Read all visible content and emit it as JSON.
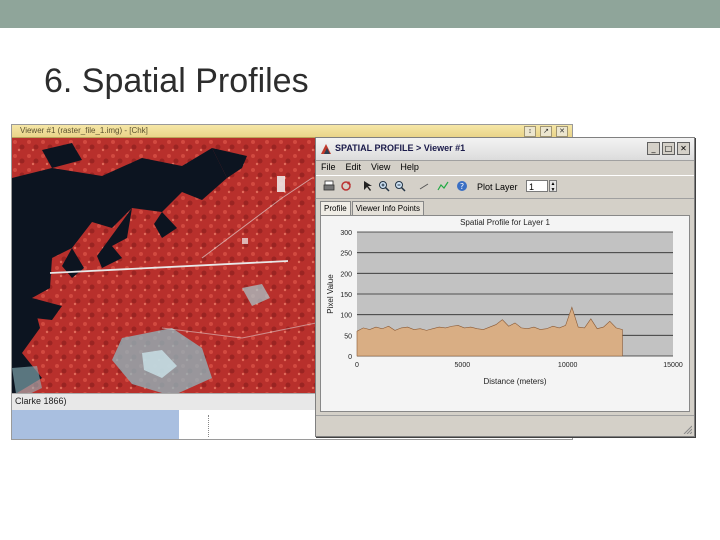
{
  "slide": {
    "title": "6. Spatial Profiles",
    "accent_color": "#8fa59a"
  },
  "viewer": {
    "title": "Viewer #1 (raster_file_1.img) - [Chk]",
    "controls": [
      "↕",
      "↗",
      "✕"
    ],
    "status_text": "Clarke 1866)",
    "image_description_icon": "satellite-false-color-image"
  },
  "profile_window": {
    "title": "SPATIAL PROFILE   > Viewer #1",
    "controls": [
      "_",
      "□",
      "✕"
    ],
    "menu": [
      "File",
      "Edit",
      "View",
      "Help"
    ],
    "toolbar": {
      "tools": [
        "print-icon",
        "refresh-icon",
        "select-arrow-icon",
        "zoom-in-icon",
        "zoom-out-icon",
        "line-tool-icon",
        "polyline-icon",
        "help-icon"
      ],
      "layer_label": "Plot Layer",
      "layer_value": "1"
    },
    "tabs": [
      "Profile",
      "Viewer Info Points"
    ],
    "active_tab": "Profile"
  },
  "chart_data": {
    "type": "area",
    "title": "Spatial Profile for Layer 1",
    "xlabel": "Distance (meters)",
    "ylabel": "Pixel Value",
    "xlim": [
      0,
      15000
    ],
    "ylim": [
      0,
      300
    ],
    "x_ticks": [
      "0",
      "5000",
      "10000",
      "15000"
    ],
    "y_ticks": [
      "0",
      "50",
      "100",
      "150",
      "200",
      "250",
      "300"
    ],
    "grid": true,
    "fill_color": "#d9ae84",
    "line_color": "#8a5a35",
    "background": "#c2c2c2",
    "x": [
      0,
      300,
      600,
      900,
      1200,
      1500,
      1800,
      2100,
      2400,
      2700,
      3000,
      3300,
      3600,
      3900,
      4200,
      4500,
      4800,
      5100,
      5400,
      5700,
      6000,
      6300,
      6600,
      6900,
      7200,
      7500,
      7800,
      8100,
      8400,
      8700,
      9000,
      9300,
      9600,
      9900,
      10200,
      10500,
      10800,
      11100,
      11400,
      11700,
      12000,
      12300,
      12600
    ],
    "values": [
      60,
      68,
      64,
      70,
      66,
      72,
      62,
      68,
      70,
      64,
      66,
      62,
      66,
      70,
      68,
      72,
      74,
      68,
      70,
      66,
      64,
      70,
      76,
      88,
      72,
      80,
      68,
      66,
      70,
      64,
      66,
      72,
      68,
      74,
      118,
      70,
      68,
      90,
      66,
      70,
      84,
      68,
      64
    ]
  }
}
